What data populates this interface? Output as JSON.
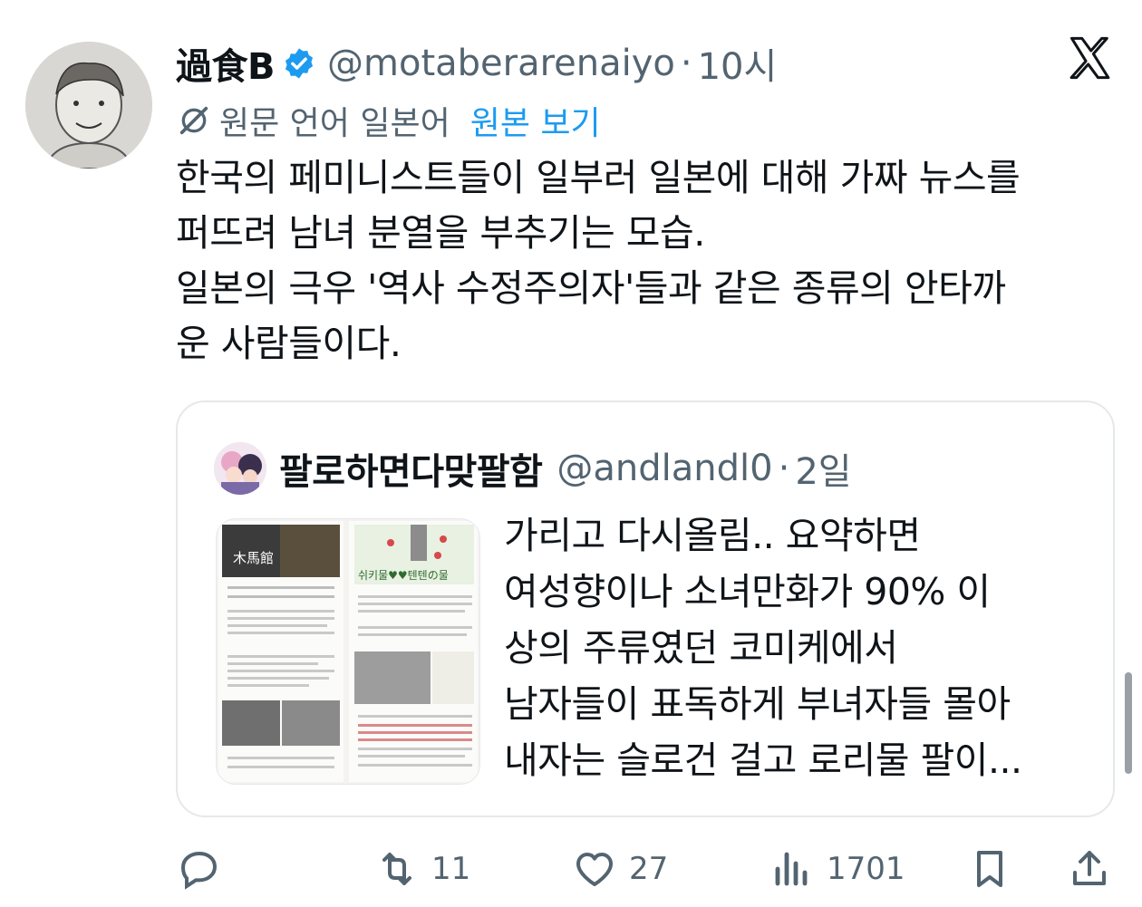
{
  "tweet": {
    "author_name": "過食B",
    "handle": "@motaberarenaiyo",
    "separator": "·",
    "time": "10시",
    "translation_label": "원문 언어 일본어",
    "show_original": "원본 보기",
    "body_lines": [
      "한국의 페미니스트들이 일부러 일본에 대해 가짜 뉴스를",
      "퍼뜨려 남녀 분열을 부추기는 모습.",
      "일본의 극우 '역사 수정주의자'들과 같은 종류의 안타까",
      "운 사람들이다."
    ]
  },
  "quoted": {
    "author_name": "팔로하면다맞팔함",
    "handle": "@andlandl0",
    "separator": "·",
    "time": "2일",
    "text_lines": [
      "가리고 다시올림.. 요약하면",
      "여성향이나 소녀만화가 90% 이",
      "상의 주류였던 코미케에서",
      "남자들이 표독하게 부녀자들 몰아",
      "내자는 슬로건 걸고 로리물 팔이..."
    ],
    "image_titles": [
      "木馬館",
      "쉬키물♥♥텐텐の물"
    ]
  },
  "actions": {
    "replies": "",
    "retweets": "11",
    "likes": "27",
    "views": "1701"
  },
  "icons": [
    "avatar",
    "verified-badge-icon",
    "x-logo-icon",
    "translate-icon",
    "reply-icon",
    "retweet-icon",
    "like-icon",
    "views-icon",
    "bookmark-icon",
    "share-icon"
  ],
  "colors": {
    "text": "#0f1419",
    "secondary": "#536471",
    "accent": "#1d9bf0",
    "border": "#e5e8eb"
  }
}
